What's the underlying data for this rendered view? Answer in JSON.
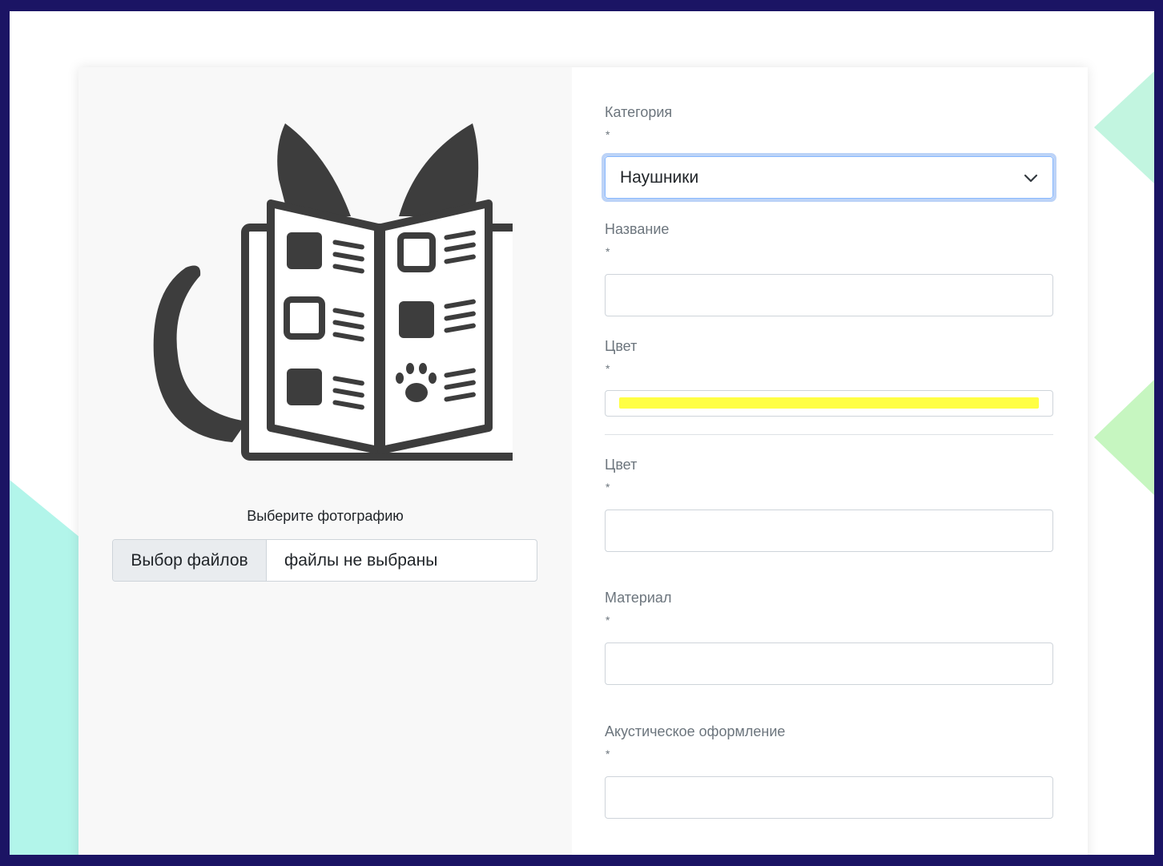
{
  "left": {
    "photo_label": "Выберите фотографию",
    "file_button": "Выбор файлов",
    "file_status": "файлы не выбраны"
  },
  "form": {
    "required_mark": "*",
    "category": {
      "label": "Категория",
      "value": "Наушники"
    },
    "name": {
      "label": "Название",
      "value": ""
    },
    "color_picker": {
      "label": "Цвет",
      "value": "#ffff44"
    },
    "color_text": {
      "label": "Цвет",
      "value": ""
    },
    "material": {
      "label": "Материал",
      "value": ""
    },
    "acoustic": {
      "label": "Акустическое оформление",
      "value": ""
    }
  },
  "icons": {
    "illustration": "cat-reading-catalog-icon",
    "select_arrow": "chevron-down-icon"
  },
  "colors": {
    "frame_border": "#1b1464",
    "focus_ring": "#bcd3f7",
    "accent_mint": "#b2f5ea",
    "accent_green": "#c6f6c0"
  }
}
